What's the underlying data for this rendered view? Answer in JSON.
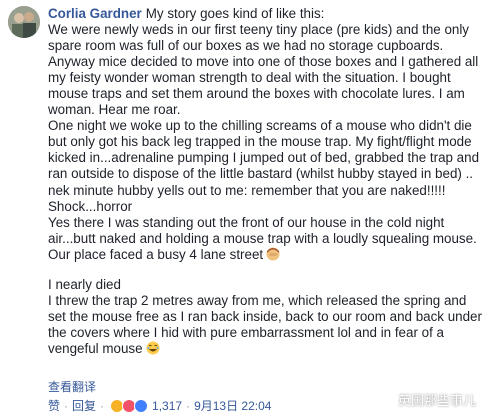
{
  "comment": {
    "author": "Corlia Gardner",
    "lines": [
      "My story goes kind of like this:",
      "We were newly weds in our first teeny tiny place (pre kids) and the only",
      "spare room was full of our boxes as we had no storage cupboards.",
      "Anyway mice decided to move into one of those boxes and I gathered all",
      "my feisty wonder woman strength to deal with the situation. I bought",
      "mouse traps and set them around the boxes with chocolate lures. I am",
      "woman. Hear me roar.",
      "One night we woke up to the chilling screams of a mouse who didn't die",
      "but only got his back leg trapped in the mouse trap. My fight/flight mode",
      "kicked in...adrenaline pumping I jumped out of bed, grabbed the trap and",
      "ran outside to dispose of the little bastard (whilst hubby stayed in bed) ..",
      "nek minute hubby yells out to me: remember that you are naked!!!!!",
      "Shock...horror",
      "Yes there I was standing out the front of our house in the cold night",
      "air...butt naked and holding a mouse trap with a loudly squealing mouse.",
      "Our place faced a busy 4 lane street"
    ],
    "lines2": [
      "I nearly died",
      "I threw the trap 2 metres away from me, which released the spring and",
      "set the mouse free as I ran back inside, back to our room and back under",
      "the covers where I hid with pure embarrassment lol and in fear of a",
      "vengeful mouse"
    ],
    "emoji1": "woman-facepalm-emoji",
    "emoji2": "laughing-emoji"
  },
  "translate_label": "查看翻译",
  "actions": {
    "like": "赞",
    "reply": "回复",
    "separator": "·",
    "reaction_count": "1,317",
    "timestamp": "9月13日 22:04",
    "reaction_colors": [
      "#f7b125",
      "#f25268",
      "#4080ff"
    ]
  },
  "watermark": {
    "text": "英国那些事儿"
  },
  "colors": {
    "link": "#365899",
    "text": "#1d2129",
    "meta": "#4b4f56"
  }
}
